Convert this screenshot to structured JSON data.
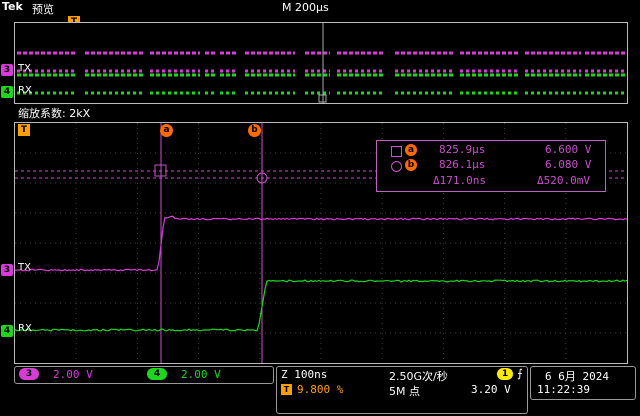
{
  "header": {
    "brand": "Tek",
    "mode": "预览",
    "timebase": "M 200µs"
  },
  "overview": {
    "ch3_label": "TX",
    "ch4_label": "RX",
    "ch3_num": "3",
    "ch4_num": "4"
  },
  "zoom": {
    "label": "缩放系数: 2kX"
  },
  "main": {
    "ch3_label": "TX",
    "ch4_label": "RX",
    "ch3_num": "3",
    "ch4_num": "4",
    "cursor_a": "a",
    "cursor_b": "b",
    "trigger_marker": "T"
  },
  "readout": {
    "a_time": "825.9µs",
    "a_volt": "6.600 V",
    "b_time": "826.1µs",
    "b_volt": "6.080 V",
    "d_time": "Δ171.0ns",
    "d_volt": "Δ520.0mV",
    "a_mark": "a",
    "b_mark": "b"
  },
  "bottom": {
    "ch3_num": "3",
    "ch3_scale": "2.00 V",
    "ch4_num": "4",
    "ch4_scale": "2.00 V",
    "zoom_time": "Z 100ns",
    "trigger_pos": "9.800 %",
    "sample_rate": "2.50G次/秒",
    "record_len": "5M 点",
    "trig_src": "1",
    "trig_slope": "⨍",
    "trig_level": "3.20 V",
    "date": "6 6月  2024",
    "time": "11:22:39"
  },
  "colors": {
    "ch3": "#d63cd6",
    "ch4": "#1fd61f",
    "cursor": "#ff6a00",
    "trigger": "#ffa000",
    "grid": "#3a3a3a"
  }
}
